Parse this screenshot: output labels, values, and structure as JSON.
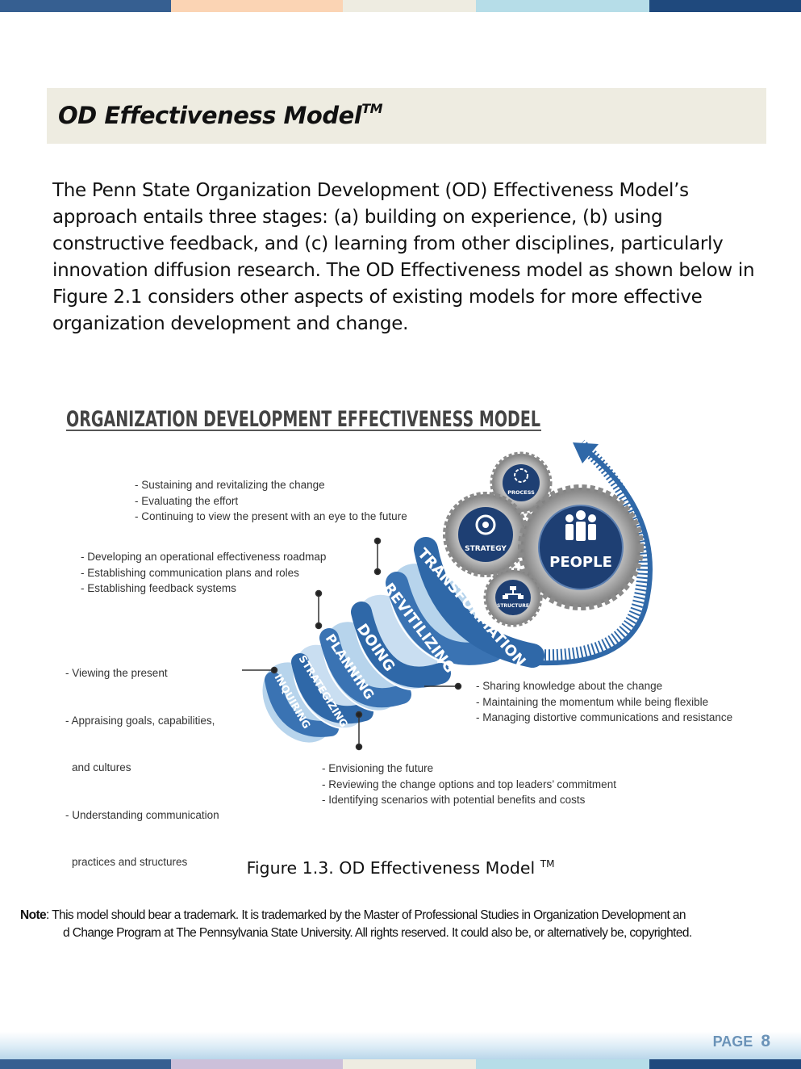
{
  "title": {
    "text": "OD Effectiveness Model",
    "tm": "TM"
  },
  "intro": "The Penn State Organization Development (OD) Effectiveness Model’s approach entails three stages: (a) building on experience, (b) using constructive feedback, and (c) learning from other disciplines, particularly innovation diffusion research. The OD Effectiveness model as shown below in Figure 2.1 considers other aspects of existing models for more effective organization development and change.",
  "figure": {
    "heading": "ORGANIZATION DEVELOPMENT EFFECTIVENESS MODEL",
    "stages": [
      "INQUIRING",
      "STRATEGIZING",
      "PLANNING",
      "DOING",
      "REVITILIZING",
      "TRANSFORMATION"
    ],
    "gears": {
      "process": "PROCESS",
      "strategy": "STRATEGY",
      "people": "PEOPLE",
      "structure": "STRUCTURE"
    },
    "annotations": {
      "sustain": [
        "- Sustaining and revitalizing the change",
        "- Evaluating the effort",
        "- Continuing to view the present with an eye to the future"
      ],
      "roadmap": [
        "- Developing an operational effectiveness roadmap",
        "- Establishing communication plans and roles",
        "- Establishing feedback systems"
      ],
      "present": [
        "- Viewing the present",
        "- Appraising goals, capabilities,",
        "  and cultures",
        "- Understanding communication",
        "  practices and structures"
      ],
      "knowledge": [
        "- Sharing knowledge about the change",
        "- Maintaining the momentum while being flexible",
        "- Managing distortive communications and resistance"
      ],
      "future": [
        "- Envisioning the future",
        "- Reviewing the change options and top leaders’ commitment",
        "- Identifying scenarios with potential benefits and costs"
      ]
    }
  },
  "caption": {
    "text": "Figure 1.3. OD Effectiveness Model ",
    "tm": "TM"
  },
  "note": {
    "label": "Note",
    "line1": ": This model should bear a trademark. It is trademarked by the Master of Professional Studies in Organization Development an",
    "line2": "d Change Program at The Pennsylvania State University. All rights reserved. It could also be, or alternatively be, copyrighted."
  },
  "footer": {
    "page_label": "PAGE",
    "page_number": "8"
  },
  "colors": {
    "title_bg": "#eeece1",
    "band_blue": "#2f68a8",
    "band_light": "#b7d4ec",
    "gear_grey": "#9c9c9c",
    "gear_center": "#1e3f73",
    "page_num": "#6b93b8",
    "top_bar": [
      "#365f91",
      "#fbd4b4",
      "#eeece1",
      "#b6dde8",
      "#1f497d"
    ],
    "bottom_bar": [
      "#365f91",
      "#ccc0da",
      "#eeece1",
      "#b6dde8",
      "#1f497d"
    ]
  }
}
